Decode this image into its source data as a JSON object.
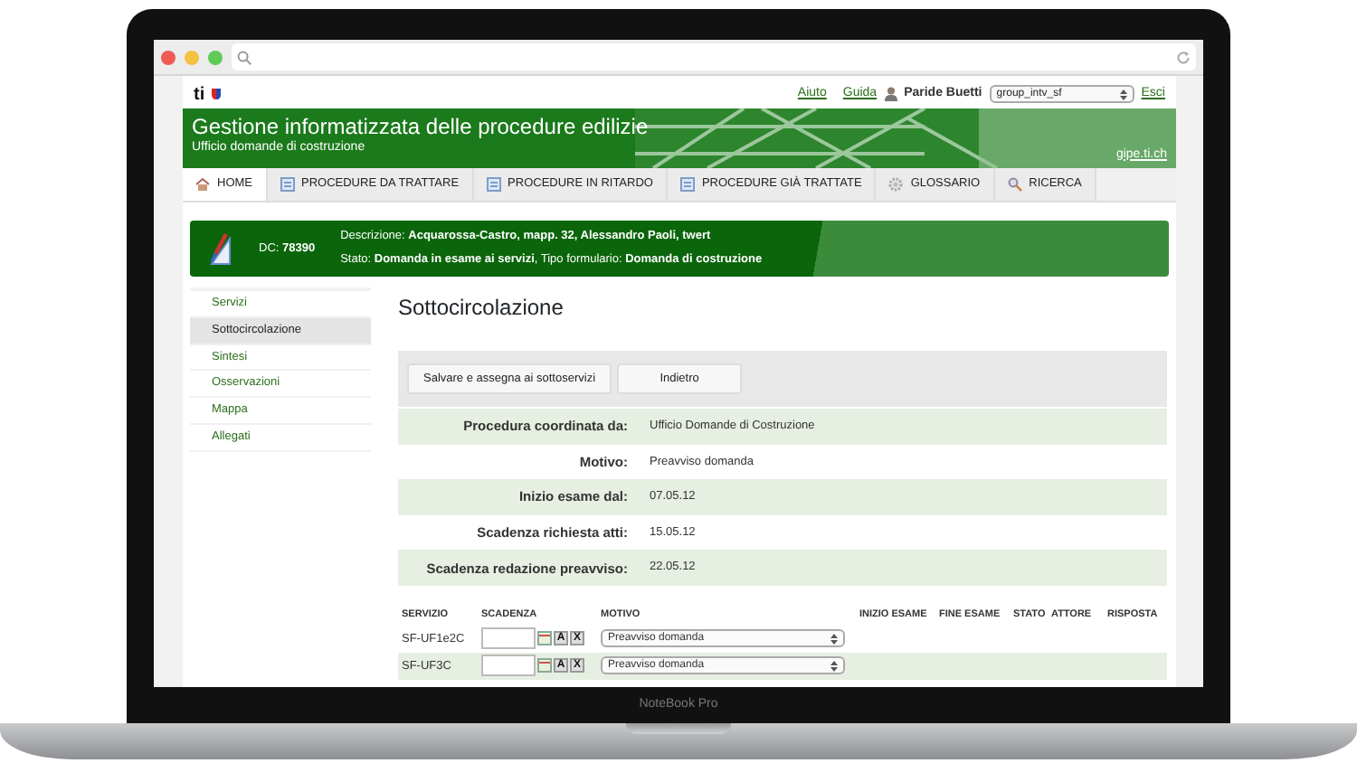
{
  "device": {
    "label": "NoteBook Pro"
  },
  "header": {
    "logo": "ti",
    "links": [
      {
        "label": "Aiuto"
      },
      {
        "label": "Guida"
      }
    ],
    "user": "Paride Buetti",
    "group": "group_intv_sf",
    "logout": "Esci"
  },
  "banner": {
    "title": "Gestione informatizzata delle procedure edilizie",
    "subtitle": "Ufficio domande di costruzione",
    "site": "gipe.ti.ch"
  },
  "nav": [
    {
      "label": "HOME",
      "kind": "home",
      "selected": true
    },
    {
      "label": "PROCEDURE DA TRATTARE",
      "kind": "list",
      "selected": false
    },
    {
      "label": "PROCEDURE IN RITARDO",
      "kind": "list",
      "selected": false
    },
    {
      "label": "PROCEDURE GIÀ TRATTATE",
      "kind": "list",
      "selected": false
    },
    {
      "label": "GLOSSARIO",
      "kind": "settings",
      "selected": false
    },
    {
      "label": "RICERCA",
      "kind": "search",
      "selected": false
    }
  ],
  "dossier": {
    "number": "DC: **78390**",
    "lines": [
      "Descrizione: **Acquarossa-Castro, mapp. 32, Alessandro Paoli, twert**",
      "Stato: **Domanda in esame ai servizi**, Tipo formulario: **Domanda di costruzione**"
    ]
  },
  "sidebar": {
    "items": [
      {
        "label": "Servizi",
        "selected": false
      },
      {
        "label": "Sottocircolazione",
        "selected": true
      },
      {
        "label": "Sintesi",
        "selected": false
      },
      {
        "label": "Osservazioni",
        "selected": false
      },
      {
        "label": "Mappa",
        "selected": false
      },
      {
        "label": "Allegati",
        "selected": false
      }
    ]
  },
  "page_title": "Sottocircolazione",
  "buttons": [
    "Salvare e assegna ai sottoservizi",
    "Indietro"
  ],
  "details": [
    {
      "label": "Procedura coordinata da:",
      "value": "Ufficio Domande di Costruzione"
    },
    {
      "label": "Motivo:",
      "value": "Preavviso domanda"
    },
    {
      "label": "Inizio esame dal:",
      "value": "07.05.12"
    },
    {
      "label": "Scadenza richiesta atti:",
      "value": "15.05.12"
    },
    {
      "label": "Scadenza redazione preavviso:",
      "value": "22.05.12"
    }
  ],
  "services": {
    "columns": [
      "SERVIZIO",
      "SCADENZA",
      "MOTIVO",
      "INIZIO ESAME",
      "FINE ESAME",
      "STATO",
      "ATTORE",
      "RISPOSTA"
    ],
    "rows": [
      {
        "servizio": "SF-UF1e2C",
        "actions": [
          "A",
          "X"
        ],
        "motivo": "Preavviso domanda"
      },
      {
        "servizio": "SF-UF3C",
        "actions": [
          "A",
          "X"
        ],
        "motivo": "Preavviso domanda"
      }
    ]
  }
}
